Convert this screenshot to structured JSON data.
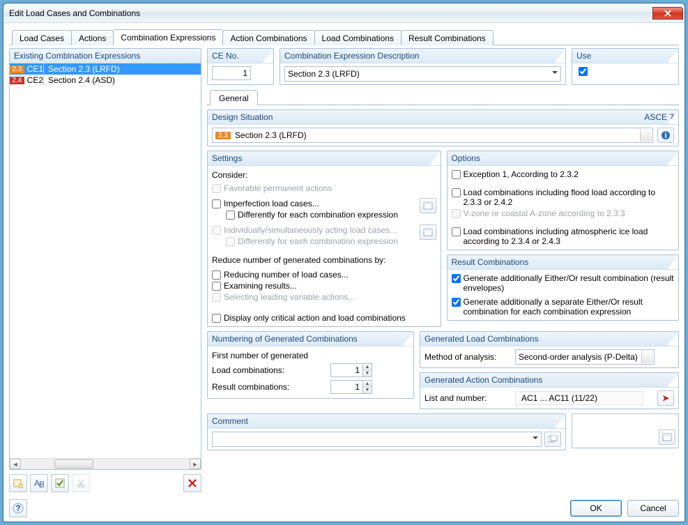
{
  "window": {
    "title": "Edit Load Cases and Combinations"
  },
  "main_tabs": [
    {
      "label": "Load Cases"
    },
    {
      "label": "Actions"
    },
    {
      "label": "Combination Expressions"
    },
    {
      "label": "Action Combinations"
    },
    {
      "label": "Load Combinations"
    },
    {
      "label": "Result Combinations"
    }
  ],
  "main_tab_active_index": 2,
  "existing": {
    "heading": "Existing Combination Expressions",
    "rows": [
      {
        "badge": "2.3",
        "badge_color": "#e58a2c",
        "id": "CE1",
        "label": "Section 2.3 (LRFD)",
        "selected": true
      },
      {
        "badge": "2.4",
        "badge_color": "#c33a2c",
        "id": "CE2",
        "label": "Section 2.4 (ASD)",
        "selected": false
      }
    ]
  },
  "ce_no": {
    "heading": "CE No.",
    "value": "1"
  },
  "description": {
    "heading": "Combination Expression Description",
    "value": "Section 2.3 (LRFD)"
  },
  "use": {
    "heading": "Use",
    "checked": true
  },
  "sub_tabs": [
    {
      "label": "General"
    }
  ],
  "design_situation": {
    "heading": "Design Situation",
    "code": "ASCE 7",
    "badge": "2.3",
    "value": "Section 2.3 (LRFD)"
  },
  "settings": {
    "heading": "Settings",
    "consider_label": "Consider:",
    "favorable": {
      "label": "Favorable permanent actions",
      "checked": false,
      "disabled": true
    },
    "imperfection": {
      "label": "Imperfection load cases...",
      "checked": false
    },
    "imperfection_diff": {
      "label": "Differently for each combination expression",
      "checked": false
    },
    "indiv": {
      "label": "Individually/simultaneously acting load cases...",
      "checked": false,
      "disabled": true
    },
    "indiv_diff": {
      "label": "Differently for each combination expression",
      "checked": false,
      "disabled": true
    },
    "reduce_label": "Reduce number of generated combinations by:",
    "reduce_lc": {
      "label": "Reducing number of load cases...",
      "checked": false
    },
    "exam": {
      "label": "Examining results...",
      "checked": false
    },
    "sel_leading": {
      "label": "Selecting leading variable actions...",
      "checked": false,
      "disabled": true
    },
    "display_crit": {
      "label": "Display only critical action and load combinations",
      "checked": false
    }
  },
  "options": {
    "heading": "Options",
    "exc1": {
      "label": "Exception 1, According to 2.3.2",
      "checked": false
    },
    "flood": {
      "label": "Load combinations including flood load according to 2.3.3 or 2.4.2",
      "checked": false
    },
    "vzone": {
      "label": "V-zone or coastal A-zone according to 2.3.3",
      "checked": false,
      "disabled": true
    },
    "ice": {
      "label": "Load combinations including atmospheric ice load according to 2.3.4 or 2.4.3",
      "checked": false
    }
  },
  "result_combinations": {
    "heading": "Result Combinations",
    "eitheror": {
      "label": "Generate additionally Either/Or result combination (result envelopes)",
      "checked": true
    },
    "separate": {
      "label": "Generate additionally a separate Either/Or result combination for each combination expression",
      "checked": true
    }
  },
  "numbering": {
    "heading": "Numbering of Generated Combinations",
    "first_label": "First number of generated",
    "load_label": "Load combinations:",
    "load_value": "1",
    "result_label": "Result combinations:",
    "result_value": "1"
  },
  "gen_load": {
    "heading": "Generated Load Combinations",
    "method_label": "Method of analysis:",
    "method_value": "Second-order analysis (P-Delta)"
  },
  "gen_action": {
    "heading": "Generated Action Combinations",
    "list_label": "List and number:",
    "list_value": "AC1 ... AC11 (11/22)"
  },
  "comment": {
    "heading": "Comment",
    "value": ""
  },
  "footer": {
    "ok": "OK",
    "cancel": "Cancel"
  }
}
